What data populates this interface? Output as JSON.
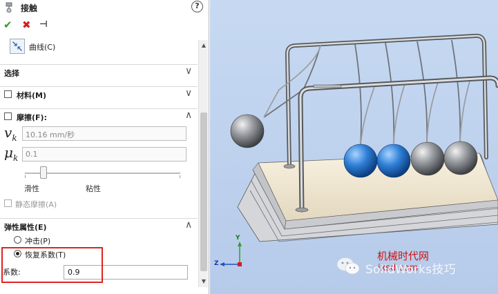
{
  "header": {
    "title": "接触",
    "help": "?"
  },
  "actions": {
    "ok": "✔",
    "cancel": "✖",
    "pin": "⊣"
  },
  "curve": {
    "label": "曲线(C)"
  },
  "sections": {
    "select": "选择",
    "material": "材料(M)",
    "friction": "摩擦(F):",
    "elastic": "弹性属性(E)"
  },
  "friction": {
    "vk_symbol": "v",
    "vk_sub": "k",
    "velocity_value": "10.16 mm/秒",
    "mu_symbol": "μ",
    "mu_sub": "k",
    "coefficient_value": "0.1",
    "slider_left": "滑性",
    "slider_right": "粘性",
    "slider_level": 0.12,
    "static_friction": "静态摩擦(A)"
  },
  "elastic": {
    "impact_label": "冲击(P)",
    "restitution_label": "恢复系数(T)",
    "selected": "restitution",
    "coef_label": "系数:",
    "coef_value": "0.9"
  },
  "viewport": {
    "triad": {
      "y": "Y",
      "z": "Z"
    },
    "watermark_cn": "机械时代网",
    "watermark_sw": "SolidWorks技巧",
    "watermark_url": "jxsd.com",
    "colors": {
      "background": "#c7d9f2",
      "blue_ball": "#2f7fd6",
      "steel_ball": "#8a8d92",
      "base": "#f3ead7"
    }
  }
}
